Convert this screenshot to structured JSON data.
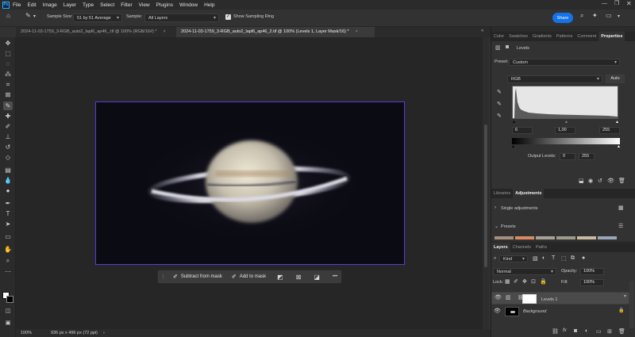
{
  "menubar": {
    "logo": "Ps",
    "items": [
      "File",
      "Edit",
      "Image",
      "Layer",
      "Type",
      "Select",
      "Filter",
      "View",
      "Plugins",
      "Window",
      "Help"
    ]
  },
  "options": {
    "sample_size_label": "Sample Size:",
    "sample_size_value": "51 by 51 Average",
    "sample_label": "Sample:",
    "sample_value": "All Layers",
    "show_ring_label": "Show Sampling Ring",
    "share_label": "Share"
  },
  "tabs": [
    {
      "label": "2024-11-03-1759_3-RGB_auto2_lapl6_ap46_.tif @ 100% (RGB/16#) *",
      "close": "×"
    },
    {
      "label": "2024-11-03-1759_3-RGB_auto2_lapl6_ap46_2.tif @ 100% (Levels 1, Layer Mask/16) *",
      "close": "×"
    }
  ],
  "taskbar": {
    "subtract_label": "Subtract from mask",
    "add_label": "Add to mask",
    "more": "•••"
  },
  "status": {
    "zoom": "100%",
    "doc_info": "936 px x 496 px (72 ppi)"
  },
  "properties": {
    "tabs": [
      "Color",
      "Swatches",
      "Gradients",
      "Patterns",
      "Comment",
      "Properties"
    ],
    "title": "Levels",
    "preset_label": "Preset:",
    "preset_value": "Custom",
    "channel_value": "RGB",
    "auto_label": "Auto",
    "input_black": "6",
    "input_gamma": "1,00",
    "input_white": "255",
    "output_label": "Output Levels:",
    "output_black": "0",
    "output_white": "255"
  },
  "libraries": {
    "tabs": [
      "Libraries",
      "Adjustments"
    ],
    "single_adjustments": "Single adjustments",
    "presets": "Presets",
    "preset_colors": [
      "#a58f7f",
      "#d98c62",
      "#a7a095",
      "#9f9a8b",
      "#c9baa0",
      "#9aa5b8"
    ]
  },
  "layers": {
    "tabs": [
      "Layers",
      "Channels",
      "Paths"
    ],
    "kind_value": "Kind",
    "blend_mode": "Normal",
    "opacity_label": "Opacity:",
    "opacity_value": "100%",
    "lock_label": "Lock:",
    "fill_label": "Fill:",
    "fill_value": "100%",
    "items": [
      {
        "name": "Levels 1",
        "selected": true
      },
      {
        "name": "Background",
        "selected": false
      }
    ]
  },
  "colors": {
    "accent": "#1473e6",
    "selection_border": "#5a3bd6"
  }
}
